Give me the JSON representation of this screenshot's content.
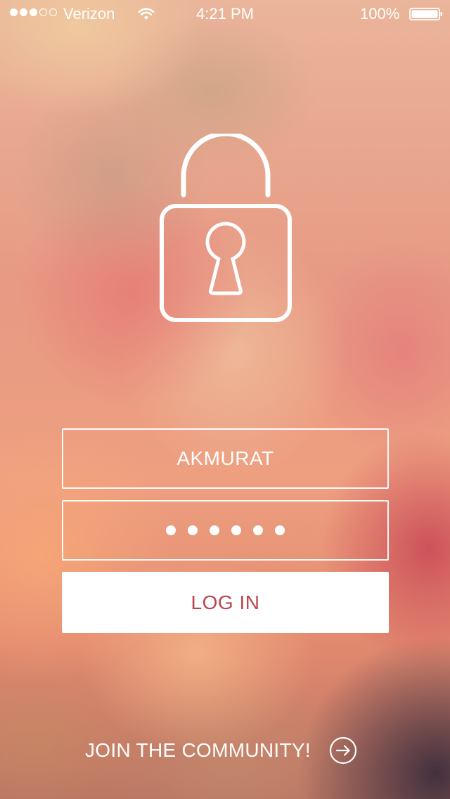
{
  "status_bar": {
    "signal_filled": 3,
    "signal_total": 5,
    "carrier": "Verizon",
    "time": "4:21 PM",
    "battery_percent": "100%",
    "battery_level": 1.0,
    "icons": [
      "signal-dots",
      "wifi-icon",
      "battery-icon"
    ]
  },
  "lock": {
    "icon": "padlock-icon"
  },
  "login_form": {
    "username_value": "AKMURAT",
    "password_length": 6,
    "login_label": "LOG IN"
  },
  "footer": {
    "join_label": "JOIN THE COMMUNITY!",
    "join_icon": "arrow-right-circle-icon"
  },
  "colors": {
    "accent_text": "#b8464e",
    "foreground": "#ffffff"
  }
}
